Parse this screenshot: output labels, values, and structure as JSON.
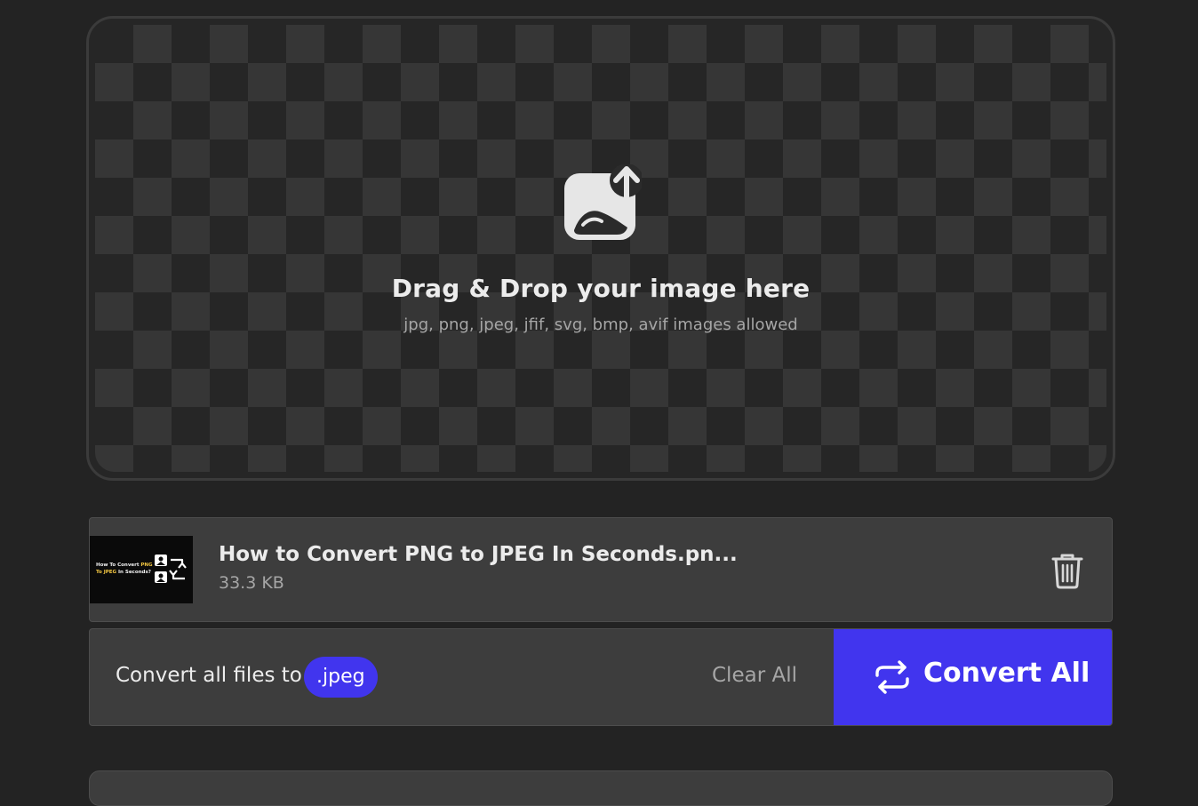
{
  "dropzone": {
    "title": "Drag & Drop your image here",
    "subtitle": "jpg, png, jpeg, jfif, svg, bmp, avif images allowed",
    "icon": "image-upload-icon"
  },
  "files": [
    {
      "name": "How to Convert PNG to JPEG In Seconds.pn...",
      "size": "33.3 KB",
      "thumbnail": {
        "line1_prefix": "How To Convert ",
        "line1_highlight": "PNG",
        "line2_highlight": "To JPEG",
        "line2_suffix": " In Seconds?",
        "icon": "image-swap-icon"
      },
      "delete_icon": "trash-icon"
    }
  ],
  "actions": {
    "convert_to_label": "Convert all files to",
    "format": ".jpeg",
    "clear_all": "Clear All",
    "convert_all": "Convert All",
    "convert_icon": "convert-arrows-icon"
  },
  "colors": {
    "background": "#232323",
    "panel": "#3d3d3d",
    "accent": "#4135ee",
    "text": "#ececec",
    "muted": "#a6a6a6"
  }
}
